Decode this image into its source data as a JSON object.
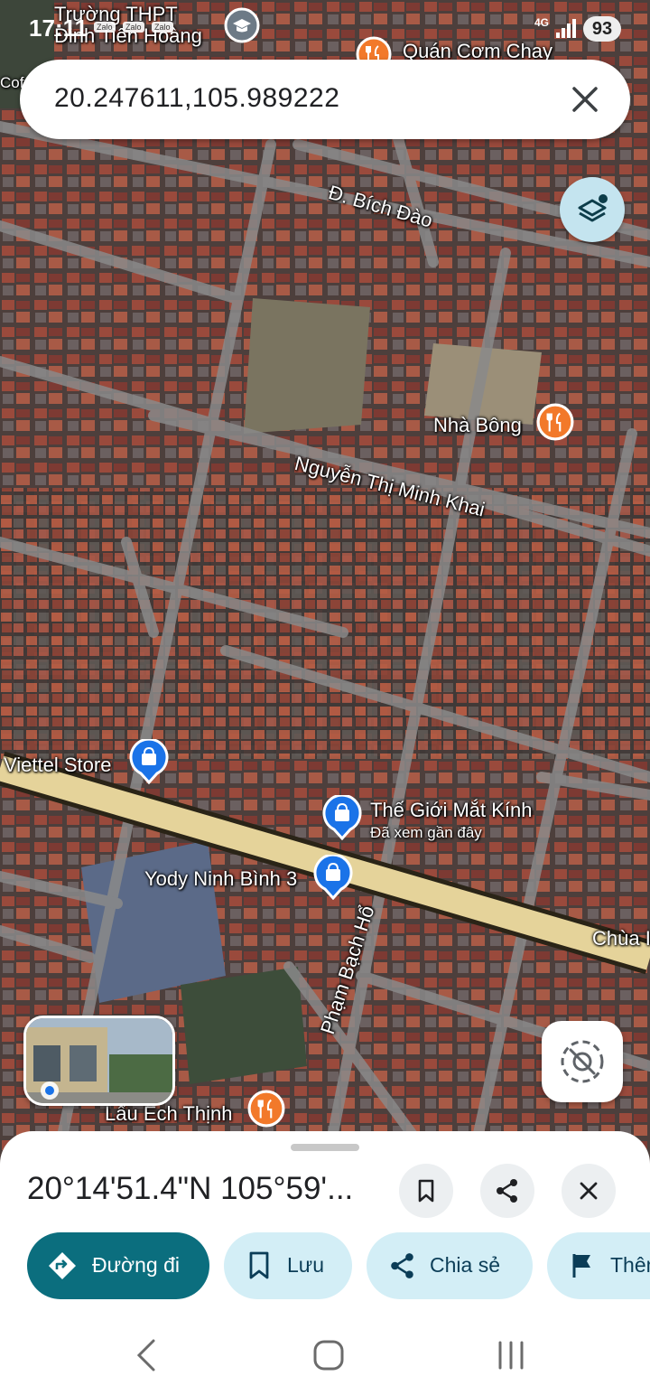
{
  "status_bar": {
    "time": "17:11",
    "network": "4G",
    "battery": "93",
    "notifications": [
      "Zalo",
      "Zalo",
      "Zalo"
    ]
  },
  "search": {
    "query": "20.247611,105.989222"
  },
  "map": {
    "labels": {
      "school": "Trường THPT\nĐinh Tiên Hoàng",
      "quan_com_chay": "Quán Cơm Chay",
      "coffee_edge": "Cof",
      "bich_dao": "Đ. Bích Đào",
      "nha_bong": "Nhà Bông",
      "nguyen_thi_minh_khai": "Nguyễn Thị Minh Khai",
      "viettel": "Viettel Store",
      "the_gioi_mat_kinh": "Thế Giới Mắt Kính",
      "da_xem": "Đã xem gần đây",
      "yody": "Yody Ninh Bình 3",
      "chua": "Chùa I",
      "pham_bach_ho": "Phạm Bạch Hổ",
      "lau_ech": "Lẩu Ếch Thịnh"
    }
  },
  "sheet": {
    "coordinates": "20°14'51.4\"N 105°59'...",
    "chips": [
      {
        "label": "Đường đi",
        "icon": "directions-icon"
      },
      {
        "label": "Lưu",
        "icon": "bookmark-icon"
      },
      {
        "label": "Chia sẻ",
        "icon": "share-icon"
      },
      {
        "label": "Thêm",
        "icon": "flag-icon"
      }
    ]
  },
  "colors": {
    "accent": "#0b6e7e",
    "chip_bg": "#d3eef6",
    "poi_blue": "#1a73e8",
    "poi_orange": "#f2792a"
  }
}
